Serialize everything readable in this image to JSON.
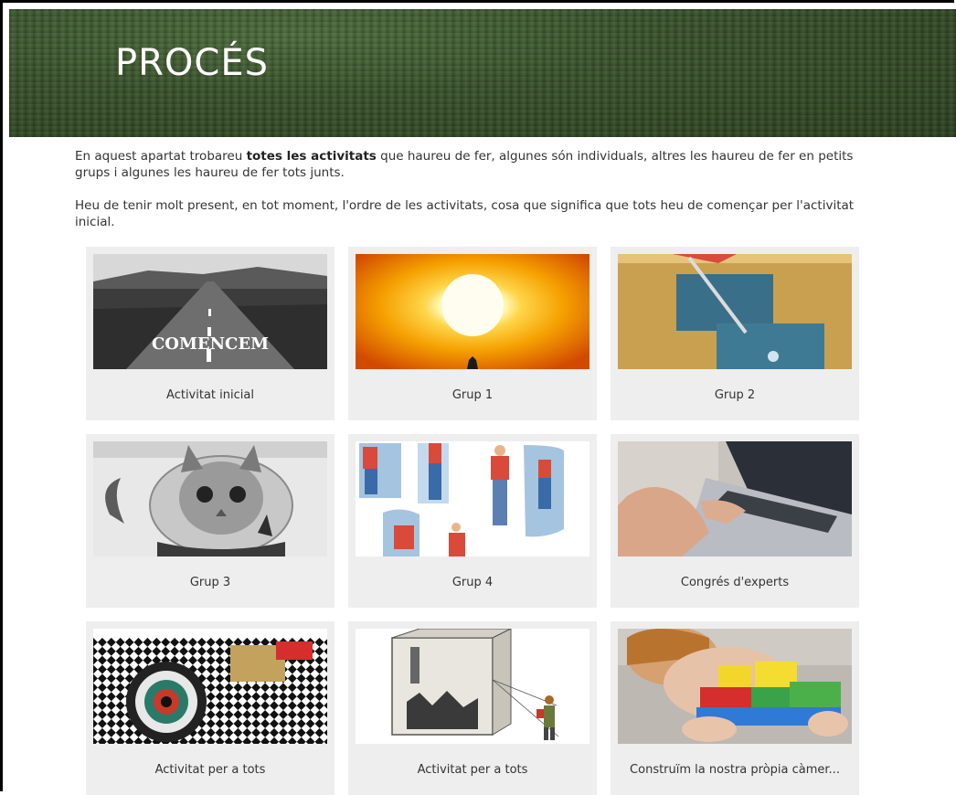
{
  "page": {
    "title": "PROCÉS",
    "intro_1_pre": "En aquest apartat trobareu ",
    "intro_1_bold": "totes les activitats",
    "intro_1_post": " que haureu de fer, algunes són individuals, altres les haureu de fer en petits grups i algunes les haureu de fer tots junts.",
    "intro_2": "Heu de tenir molt present, en tot moment, l'ordre de les activitats, cosa que significa que tots heu de començar per l'activitat inicial."
  },
  "cards": [
    {
      "label": "Activitat inicial",
      "image_text": "COMENCEM"
    },
    {
      "label": "Grup 1"
    },
    {
      "label": "Grup 2"
    },
    {
      "label": "Grup 3"
    },
    {
      "label": "Grup 4"
    },
    {
      "label": "Congrés d'experts"
    },
    {
      "label": "Activitat per a tots"
    },
    {
      "label": "Activitat per a tots"
    },
    {
      "label": "Construïm la nostra pròpia càmer..."
    }
  ],
  "colors": {
    "banner": "#3a542c",
    "card_bg": "#eeeeee",
    "text": "#333333"
  }
}
